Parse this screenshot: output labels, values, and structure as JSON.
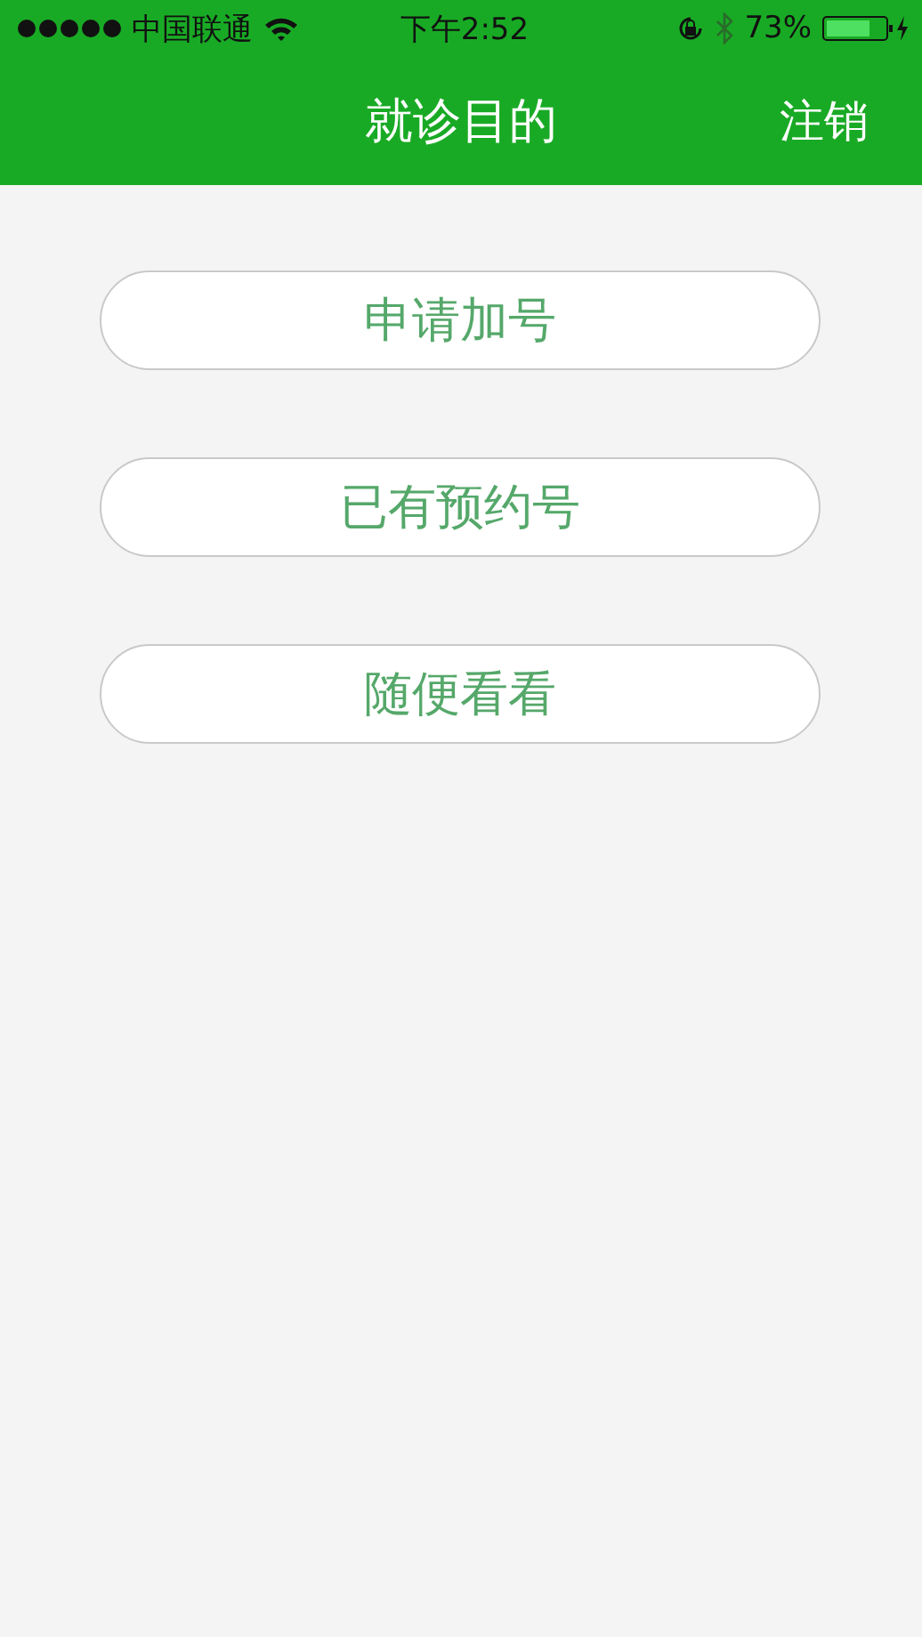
{
  "status_bar": {
    "carrier": "中国联通",
    "time": "下午2:52",
    "battery": "73%"
  },
  "nav_bar": {
    "title": "就诊目的",
    "action": "注销"
  },
  "options": [
    {
      "label": "申请加号"
    },
    {
      "label": "已有预约号"
    },
    {
      "label": "随便看看"
    }
  ]
}
